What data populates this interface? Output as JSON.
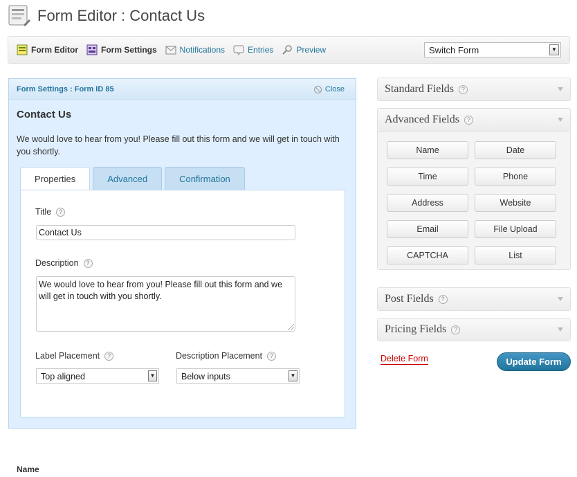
{
  "header": {
    "title": "Form Editor : Contact Us",
    "icon": "form-editor-icon"
  },
  "toolbar": {
    "items": [
      {
        "label": "Form Editor",
        "icon": "form-editor-icon"
      },
      {
        "label": "Form Settings",
        "icon": "form-settings-icon"
      },
      {
        "label": "Notifications",
        "icon": "notifications-icon"
      },
      {
        "label": "Entries",
        "icon": "entries-icon"
      },
      {
        "label": "Preview",
        "icon": "preview-icon"
      }
    ],
    "switch_form": "Switch Form"
  },
  "settings": {
    "heading": "Form Settings : Form ID 85",
    "close_label": "Close",
    "form_name": "Contact Us",
    "form_description": "We would love to hear from you! Please fill out this form and we will get in touch with you shortly.",
    "tabs": [
      "Properties",
      "Advanced",
      "Confirmation"
    ],
    "active_tab": "Properties",
    "title_label": "Title",
    "title_value": "Contact Us",
    "description_label": "Description",
    "description_value": "We would love to hear from you! Please fill out this form and we will get in touch with you shortly.",
    "label_placement_label": "Label Placement",
    "label_placement_value": "Top aligned",
    "description_placement_label": "Description Placement",
    "description_placement_value": "Below inputs",
    "help_glyph": "?"
  },
  "sidebar": {
    "standard_fields": "Standard Fields",
    "advanced_fields": "Advanced Fields",
    "advanced_buttons": [
      "Name",
      "Date",
      "Time",
      "Phone",
      "Address",
      "Website",
      "Email",
      "File Upload",
      "CAPTCHA",
      "List"
    ],
    "post_fields": "Post Fields",
    "pricing_fields": "Pricing Fields"
  },
  "actions": {
    "delete": "Delete Form",
    "update": "Update Form"
  },
  "footer": {
    "field_label": "Name"
  },
  "colors": {
    "link": "#21759b",
    "panel_bg": "#dfefff",
    "delete": "#cc0000",
    "primary_button": "#21759b"
  }
}
